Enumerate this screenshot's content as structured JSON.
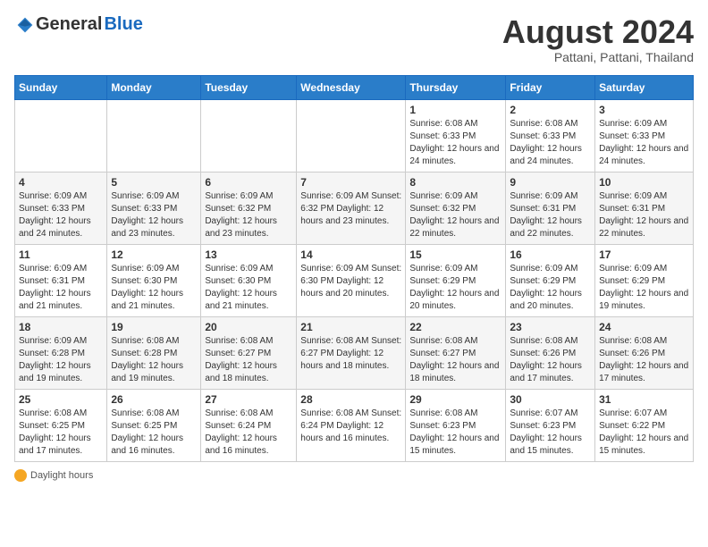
{
  "logo": {
    "general": "General",
    "blue": "Blue"
  },
  "title": "August 2024",
  "subtitle": "Pattani, Pattani, Thailand",
  "days_of_week": [
    "Sunday",
    "Monday",
    "Tuesday",
    "Wednesday",
    "Thursday",
    "Friday",
    "Saturday"
  ],
  "footer": {
    "label": "Daylight hours"
  },
  "weeks": [
    [
      {
        "day": "",
        "info": ""
      },
      {
        "day": "",
        "info": ""
      },
      {
        "day": "",
        "info": ""
      },
      {
        "day": "",
        "info": ""
      },
      {
        "day": "1",
        "info": "Sunrise: 6:08 AM\nSunset: 6:33 PM\nDaylight: 12 hours and 24 minutes."
      },
      {
        "day": "2",
        "info": "Sunrise: 6:08 AM\nSunset: 6:33 PM\nDaylight: 12 hours and 24 minutes."
      },
      {
        "day": "3",
        "info": "Sunrise: 6:09 AM\nSunset: 6:33 PM\nDaylight: 12 hours and 24 minutes."
      }
    ],
    [
      {
        "day": "4",
        "info": "Sunrise: 6:09 AM\nSunset: 6:33 PM\nDaylight: 12 hours and 24 minutes."
      },
      {
        "day": "5",
        "info": "Sunrise: 6:09 AM\nSunset: 6:33 PM\nDaylight: 12 hours and 23 minutes."
      },
      {
        "day": "6",
        "info": "Sunrise: 6:09 AM\nSunset: 6:32 PM\nDaylight: 12 hours and 23 minutes."
      },
      {
        "day": "7",
        "info": "Sunrise: 6:09 AM\nSunset: 6:32 PM\nDaylight: 12 hours and 23 minutes."
      },
      {
        "day": "8",
        "info": "Sunrise: 6:09 AM\nSunset: 6:32 PM\nDaylight: 12 hours and 22 minutes."
      },
      {
        "day": "9",
        "info": "Sunrise: 6:09 AM\nSunset: 6:31 PM\nDaylight: 12 hours and 22 minutes."
      },
      {
        "day": "10",
        "info": "Sunrise: 6:09 AM\nSunset: 6:31 PM\nDaylight: 12 hours and 22 minutes."
      }
    ],
    [
      {
        "day": "11",
        "info": "Sunrise: 6:09 AM\nSunset: 6:31 PM\nDaylight: 12 hours and 21 minutes."
      },
      {
        "day": "12",
        "info": "Sunrise: 6:09 AM\nSunset: 6:30 PM\nDaylight: 12 hours and 21 minutes."
      },
      {
        "day": "13",
        "info": "Sunrise: 6:09 AM\nSunset: 6:30 PM\nDaylight: 12 hours and 21 minutes."
      },
      {
        "day": "14",
        "info": "Sunrise: 6:09 AM\nSunset: 6:30 PM\nDaylight: 12 hours and 20 minutes."
      },
      {
        "day": "15",
        "info": "Sunrise: 6:09 AM\nSunset: 6:29 PM\nDaylight: 12 hours and 20 minutes."
      },
      {
        "day": "16",
        "info": "Sunrise: 6:09 AM\nSunset: 6:29 PM\nDaylight: 12 hours and 20 minutes."
      },
      {
        "day": "17",
        "info": "Sunrise: 6:09 AM\nSunset: 6:29 PM\nDaylight: 12 hours and 19 minutes."
      }
    ],
    [
      {
        "day": "18",
        "info": "Sunrise: 6:09 AM\nSunset: 6:28 PM\nDaylight: 12 hours and 19 minutes."
      },
      {
        "day": "19",
        "info": "Sunrise: 6:08 AM\nSunset: 6:28 PM\nDaylight: 12 hours and 19 minutes."
      },
      {
        "day": "20",
        "info": "Sunrise: 6:08 AM\nSunset: 6:27 PM\nDaylight: 12 hours and 18 minutes."
      },
      {
        "day": "21",
        "info": "Sunrise: 6:08 AM\nSunset: 6:27 PM\nDaylight: 12 hours and 18 minutes."
      },
      {
        "day": "22",
        "info": "Sunrise: 6:08 AM\nSunset: 6:27 PM\nDaylight: 12 hours and 18 minutes."
      },
      {
        "day": "23",
        "info": "Sunrise: 6:08 AM\nSunset: 6:26 PM\nDaylight: 12 hours and 17 minutes."
      },
      {
        "day": "24",
        "info": "Sunrise: 6:08 AM\nSunset: 6:26 PM\nDaylight: 12 hours and 17 minutes."
      }
    ],
    [
      {
        "day": "25",
        "info": "Sunrise: 6:08 AM\nSunset: 6:25 PM\nDaylight: 12 hours and 17 minutes."
      },
      {
        "day": "26",
        "info": "Sunrise: 6:08 AM\nSunset: 6:25 PM\nDaylight: 12 hours and 16 minutes."
      },
      {
        "day": "27",
        "info": "Sunrise: 6:08 AM\nSunset: 6:24 PM\nDaylight: 12 hours and 16 minutes."
      },
      {
        "day": "28",
        "info": "Sunrise: 6:08 AM\nSunset: 6:24 PM\nDaylight: 12 hours and 16 minutes."
      },
      {
        "day": "29",
        "info": "Sunrise: 6:08 AM\nSunset: 6:23 PM\nDaylight: 12 hours and 15 minutes."
      },
      {
        "day": "30",
        "info": "Sunrise: 6:07 AM\nSunset: 6:23 PM\nDaylight: 12 hours and 15 minutes."
      },
      {
        "day": "31",
        "info": "Sunrise: 6:07 AM\nSunset: 6:22 PM\nDaylight: 12 hours and 15 minutes."
      }
    ]
  ]
}
